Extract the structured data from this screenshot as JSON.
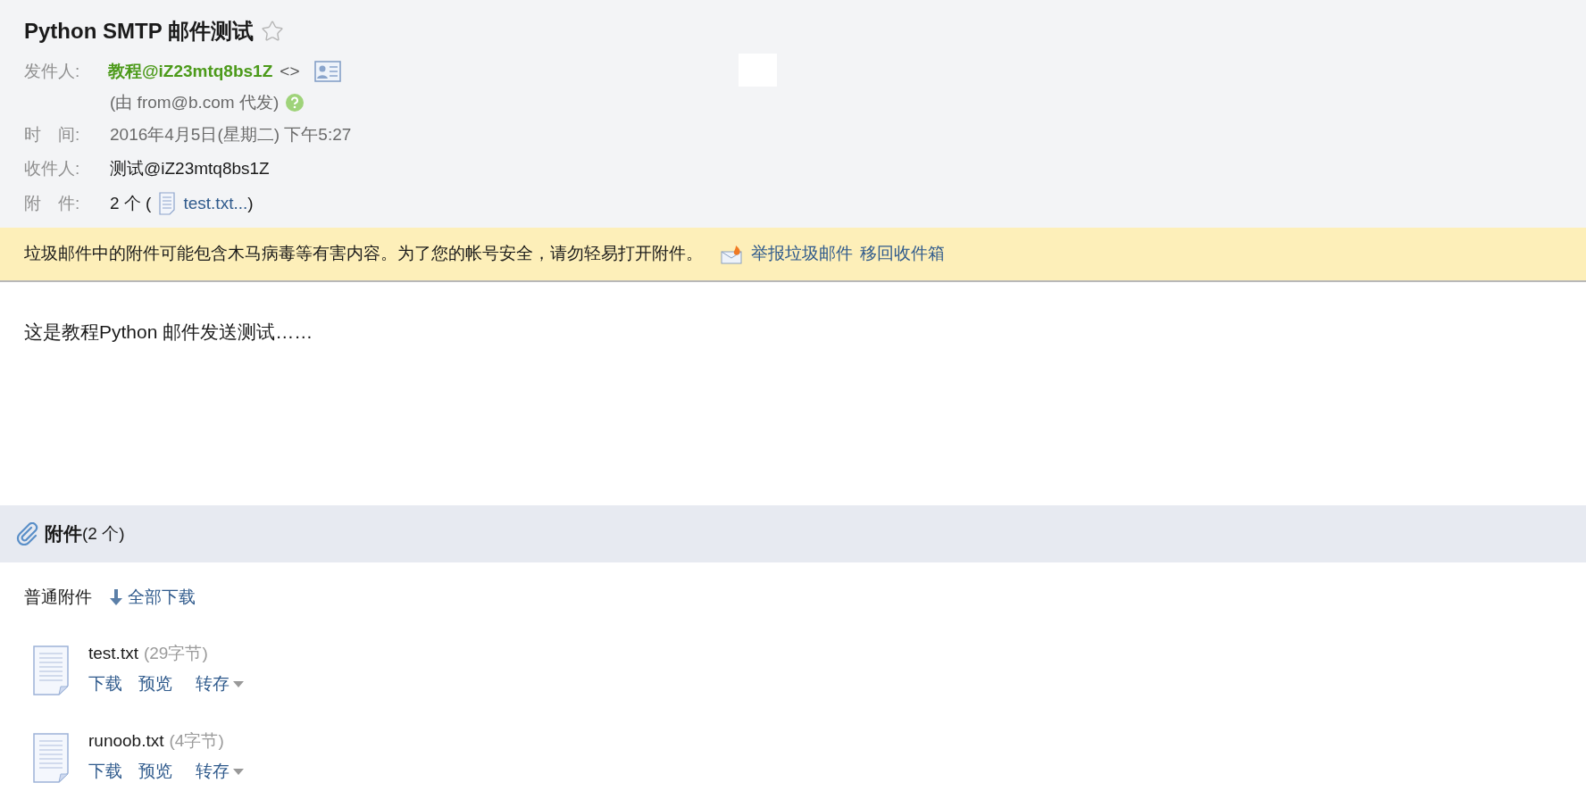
{
  "email": {
    "subject": "Python SMTP 邮件测试",
    "starred": false,
    "sender": {
      "label": "发件人:",
      "name": "教程@iZ23mtq8bs1Z",
      "address": "<>",
      "via": "(由 from@b.com 代发)"
    },
    "time": {
      "label": "时　间:",
      "value": "2016年4月5日(星期二) 下午5:27"
    },
    "recipient": {
      "label": "收件人:",
      "value": "测试@iZ23mtq8bs1Z"
    },
    "attachments_summary": {
      "label": "附　件:",
      "count": "2 个 (",
      "file": "test.txt...",
      "close": ")"
    }
  },
  "warning": {
    "text": "垃圾邮件中的附件可能包含木马病毒等有害内容。为了您的帐号安全，请勿轻易打开附件。",
    "actions": [
      "举报垃圾邮件",
      "移回收件箱"
    ]
  },
  "body": "这是教程Python 邮件发送测试……",
  "attachments": {
    "title": "附件",
    "count": "(2 个)",
    "group_label": "普通附件",
    "download_all": "全部下载",
    "files": [
      {
        "name": "test.txt",
        "size": "(29字节)",
        "actions": [
          "下载",
          "预览",
          "转存"
        ]
      },
      {
        "name": "runoob.txt",
        "size": "(4字节)",
        "actions": [
          "下载",
          "预览",
          "转存"
        ]
      }
    ]
  }
}
